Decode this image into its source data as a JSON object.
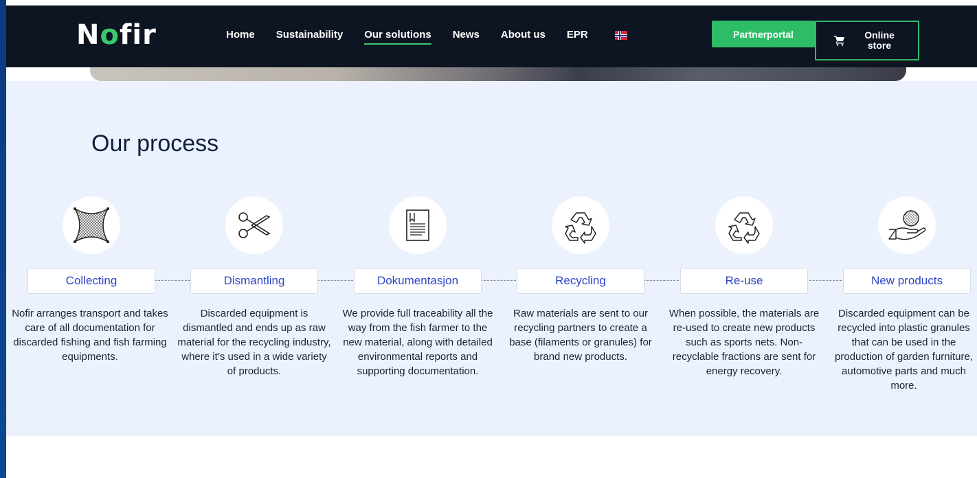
{
  "nav": {
    "logo": {
      "prefix": "N",
      "o": "o",
      "suffix": "fir"
    },
    "items": [
      {
        "label": "Home",
        "active": false
      },
      {
        "label": "Sustainability",
        "active": false
      },
      {
        "label": "Our solutions",
        "active": true
      },
      {
        "label": "News",
        "active": false
      },
      {
        "label": "About us",
        "active": false
      },
      {
        "label": "EPR",
        "active": false
      }
    ],
    "language_icon": "norwegian-flag-icon",
    "partner_label": "Partnerportal",
    "store_label": "Online store",
    "store_icon": "cart-icon"
  },
  "process": {
    "title": "Our process",
    "steps": [
      {
        "title": "Collecting",
        "icon": "net-icon",
        "desc": "Nofir arranges transport and takes care of all documentation for discarded fishing and fish farming equipments."
      },
      {
        "title": "Dismantling",
        "icon": "scissors-icon",
        "desc": "Discarded equipment is dismantled and ends up as raw material for the recycling industry, where it’s used in a wide variety of products."
      },
      {
        "title": "Dokumentasjon",
        "icon": "document-icon",
        "desc": "We provide full traceability all the way from the fish farmer to the new material, along with detailed environmental reports and supporting documentation."
      },
      {
        "title": "Recycling",
        "icon": "recycle-icon",
        "desc": "Raw materials are sent to our recycling partners to create a base (filaments or granules) for brand new products."
      },
      {
        "title": "Re-use",
        "icon": "recycle-icon",
        "desc": "When possible, the materials are re-used to create new products such as sports nets. Non-recyclable fractions are sent for energy recovery."
      },
      {
        "title": "New products",
        "icon": "hand-ball-icon",
        "desc": "Discarded equipment can be recycled into plastic granules that can be used in the production of garden furniture, automotive parts and much more."
      }
    ]
  },
  "colors": {
    "accent": "#2ebd67",
    "nav_bg": "#0d1422",
    "section_bg": "#ebf2fd",
    "step_title": "#2c45c9"
  }
}
